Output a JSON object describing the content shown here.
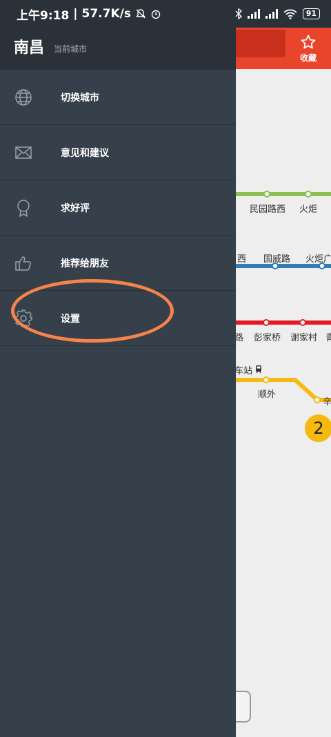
{
  "status_bar": {
    "time": "上午9:18",
    "speed": "57.7K/s",
    "signal1": "HD",
    "signal2": "HD",
    "battery": "91"
  },
  "map": {
    "favorite_label": "收藏",
    "line_badge": "2",
    "stations": {
      "minyuanluxi": "民园路西",
      "huoju": "火炬",
      "xi": "西",
      "guoweilu": "国威路",
      "huojuguang": "火炬广",
      "lu": "路",
      "pengjiaqiao": "彭家桥",
      "xiejiacun": "谢家村",
      "qing": "青",
      "zhan": "车站",
      "shunwai": "顺外",
      "xin": "辛"
    },
    "colors": {
      "green_line": "#8cc152",
      "blue_line": "#2f7fb5",
      "red_line": "#e21a23",
      "yellow_line": "#f5b90f",
      "header": "#e8452c"
    }
  },
  "drawer": {
    "city": "南昌",
    "city_subtitle": "当前城市",
    "items": [
      {
        "label": "切换城市",
        "icon": "globe-icon"
      },
      {
        "label": "意见和建议",
        "icon": "mail-icon"
      },
      {
        "label": "求好评",
        "icon": "award-icon"
      },
      {
        "label": "推荐给朋友",
        "icon": "thumbs-up-icon"
      },
      {
        "label": "设置",
        "icon": "gear-icon"
      }
    ]
  }
}
